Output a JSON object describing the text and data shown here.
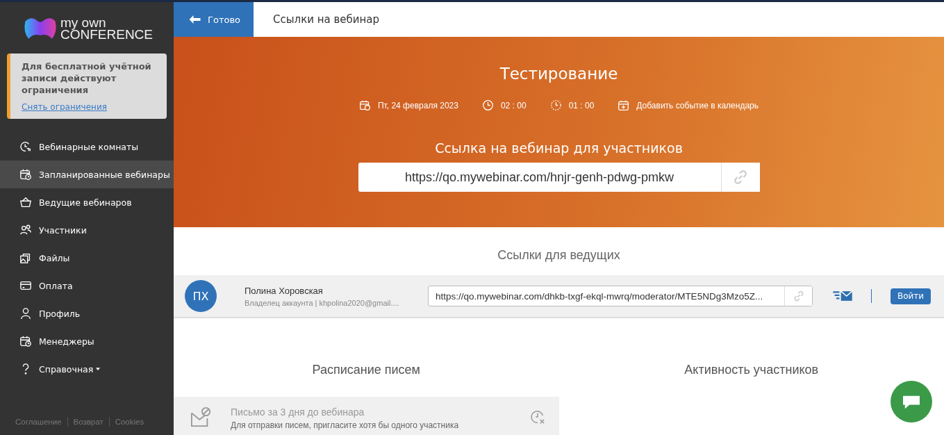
{
  "logo": {
    "line1": "my own",
    "line2": "CONFERENCE"
  },
  "notice": {
    "text": "Для бесплатной учётной записи действуют ограничения",
    "link": "Снять ограничения"
  },
  "sidebar": {
    "items": [
      {
        "label": "Вебинарные комнаты",
        "selected": false
      },
      {
        "label": "Запланированные вебинары",
        "selected": true
      },
      {
        "label": "Ведущие вебинаров",
        "selected": false
      },
      {
        "label": "Участники",
        "selected": false
      },
      {
        "label": "Файлы",
        "selected": false
      },
      {
        "label": "Оплата",
        "selected": false
      },
      {
        "label": "Профиль",
        "selected": false
      },
      {
        "label": "Менеджеры",
        "selected": false
      },
      {
        "label": "Справочная",
        "selected": false,
        "dropdown": true
      }
    ]
  },
  "footer_links": [
    "Соглашение",
    "Возврат",
    "Cookies"
  ],
  "topbar": {
    "back_button": "Готово",
    "title": "Ссылки на вебинар"
  },
  "banner": {
    "title": "Тестирование",
    "date": "Пт, 24 февраля 2023",
    "time": "02 : 00",
    "duration": "01 : 00",
    "add_to_calendar": "Добавить событие в календарь",
    "link_heading": "Ссылка на вебинар для участников",
    "link": "https://qo.mywebinar.com/hnjr-genh-pdwg-pmkw"
  },
  "hosts": {
    "heading": "Ссылки для ведущих",
    "rows": [
      {
        "initials": "ПХ",
        "name": "Полина Хоровская",
        "subtitle": "Владелец аккаунта | khpolina2020@gmail....",
        "link": "https://qo.mywebinar.com/dhkb-txgf-ekql-mwrq/moderator/MTE5NDg3Mzo5Z...",
        "enter": "Войти"
      }
    ]
  },
  "schedule": {
    "heading": "Расписание писем",
    "letters": [
      {
        "title": "Письмо за 3 дня до вебинара",
        "note": "Для отправки писем, пригласите хотя бы одного участника"
      }
    ]
  },
  "activity": {
    "heading": "Активность участников"
  }
}
